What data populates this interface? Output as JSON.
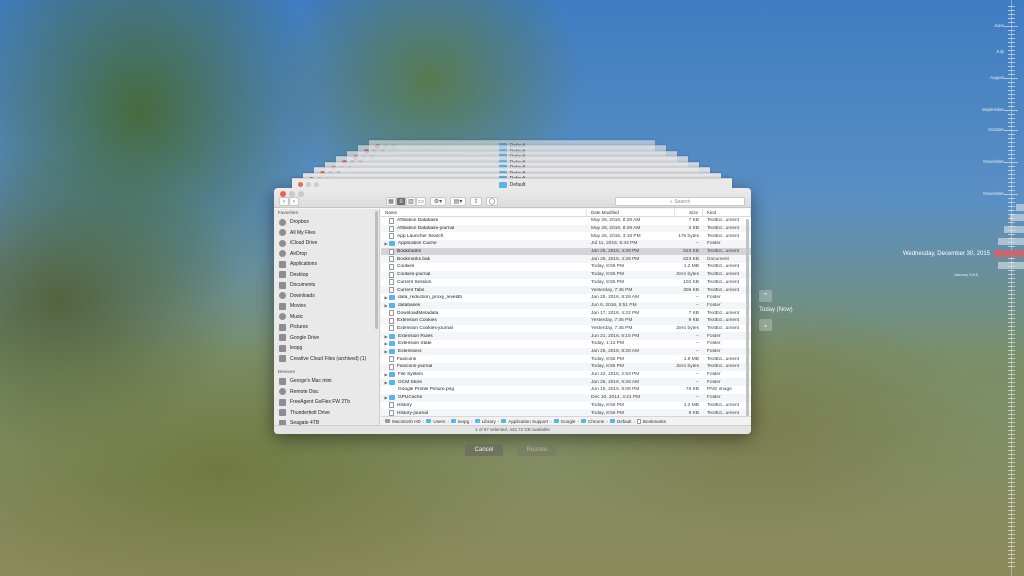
{
  "window_stack": [
    {
      "title": "Default"
    },
    {
      "title": "Default"
    },
    {
      "title": "Default"
    },
    {
      "title": "Default"
    },
    {
      "title": "Default"
    },
    {
      "title": "Default"
    },
    {
      "title": "Default"
    },
    {
      "title": "Default"
    }
  ],
  "finder": {
    "search_placeholder": "Search",
    "sidebar": {
      "favorites_heading": "Favorites",
      "favorites": [
        {
          "label": "Dropbox",
          "icon": "dropbox-icon"
        },
        {
          "label": "All My Files",
          "icon": "all-files-icon"
        },
        {
          "label": "iCloud Drive",
          "icon": "cloud-icon"
        },
        {
          "label": "AirDrop",
          "icon": "airdrop-icon"
        },
        {
          "label": "Applications",
          "icon": "applications-icon"
        },
        {
          "label": "Desktop",
          "icon": "desktop-icon"
        },
        {
          "label": "Documents",
          "icon": "documents-icon"
        },
        {
          "label": "Downloads",
          "icon": "downloads-icon"
        },
        {
          "label": "Movies",
          "icon": "movies-icon"
        },
        {
          "label": "Music",
          "icon": "music-icon"
        },
        {
          "label": "Pictures",
          "icon": "pictures-icon"
        },
        {
          "label": "Google Drive",
          "icon": "google-drive-icon"
        },
        {
          "label": "leopg",
          "icon": "home-icon"
        },
        {
          "label": "Creative Cloud Files (archived) (1)",
          "icon": "folder-icon"
        }
      ],
      "devices_heading": "Devices",
      "devices": [
        {
          "label": "George's Mac mini",
          "icon": "computer-icon"
        },
        {
          "label": "Remote Disc",
          "icon": "disc-icon"
        },
        {
          "label": "FreeAgent GoFlex FW 2Tb",
          "icon": "drive-icon"
        },
        {
          "label": "Thunderbolt Drive",
          "icon": "drive-icon"
        },
        {
          "label": "Seagate 4TB",
          "icon": "drive-icon"
        }
      ]
    },
    "columns": {
      "name": "Name",
      "date": "Date Modified",
      "size": "Size",
      "kind": "Kind"
    },
    "files": [
      {
        "name": "Affiliation Database",
        "date": "May 28, 2016, 8:29 AM",
        "size": "7 KB",
        "kind": "TextEd...ument",
        "type": "file"
      },
      {
        "name": "Affiliation Database-journal",
        "date": "May 28, 2016, 8:29 AM",
        "size": "2 KB",
        "kind": "TextEd...ument",
        "type": "file"
      },
      {
        "name": "App Launcher Search",
        "date": "May 28, 2016, 3:18 PM",
        "size": "176 bytes",
        "kind": "TextEd...ument",
        "type": "file"
      },
      {
        "name": "Application Cache",
        "date": "Jul 11, 2016, 6:44 PM",
        "size": "--",
        "kind": "Folder",
        "type": "folder"
      },
      {
        "name": "Bookmarks",
        "date": "Jan 25, 2016, 4:28 PM",
        "size": "623 KB",
        "kind": "TextEd...ument",
        "type": "file",
        "selected": true
      },
      {
        "name": "Bookmarks.bak",
        "date": "Jan 25, 2016, 4:28 PM",
        "size": "623 KB",
        "kind": "Document",
        "type": "file"
      },
      {
        "name": "Cookies",
        "date": "Today, 8:56 PM",
        "size": "1.2 MB",
        "kind": "TextEd...ument",
        "type": "file"
      },
      {
        "name": "Cookies-journal",
        "date": "Today, 8:56 PM",
        "size": "Zero bytes",
        "kind": "TextEd...ument",
        "type": "file"
      },
      {
        "name": "Current Session",
        "date": "Today, 8:55 PM",
        "size": "102 KB",
        "kind": "TextEd...ument",
        "type": "file"
      },
      {
        "name": "Current Tabs",
        "date": "Yesterday, 7:45 PM",
        "size": "306 KB",
        "kind": "TextEd...ument",
        "type": "file"
      },
      {
        "name": "data_reduction_proxy_leveldb",
        "date": "Jan 25, 2016, 8:28 AM",
        "size": "--",
        "kind": "Folder",
        "type": "folder"
      },
      {
        "name": "databases",
        "date": "Jun 6, 2016, 5:51 PM",
        "size": "--",
        "kind": "Folder",
        "type": "folder"
      },
      {
        "name": "DownloadMetadata",
        "date": "Jan 17, 2016, 4:22 PM",
        "size": "7 KB",
        "kind": "TextEd...ument",
        "type": "file"
      },
      {
        "name": "Extension Cookies",
        "date": "Yesterday, 7:45 PM",
        "size": "9 KB",
        "kind": "TextEd...ument",
        "type": "file"
      },
      {
        "name": "Extension Cookies-journal",
        "date": "Yesterday, 7:45 PM",
        "size": "Zero bytes",
        "kind": "TextEd...ument",
        "type": "file"
      },
      {
        "name": "Extension Rules",
        "date": "Jun 21, 2016, 6:15 PM",
        "size": "--",
        "kind": "Folder",
        "type": "folder"
      },
      {
        "name": "Extension State",
        "date": "Today, 1:13 PM",
        "size": "--",
        "kind": "Folder",
        "type": "folder"
      },
      {
        "name": "Extensions",
        "date": "Jan 25, 2016, 8:28 AM",
        "size": "--",
        "kind": "Folder",
        "type": "folder"
      },
      {
        "name": "Favicons",
        "date": "Today, 8:55 PM",
        "size": "1.8 MB",
        "kind": "TextEd...ument",
        "type": "file"
      },
      {
        "name": "Favicons-journal",
        "date": "Today, 8:55 PM",
        "size": "Zero bytes",
        "kind": "TextEd...ument",
        "type": "file"
      },
      {
        "name": "File System",
        "date": "Jun 22, 2016, 2:53 PM",
        "size": "--",
        "kind": "Folder",
        "type": "folder"
      },
      {
        "name": "GCM Store",
        "date": "Jan 25, 2016, 8:28 AM",
        "size": "--",
        "kind": "Folder",
        "type": "folder"
      },
      {
        "name": "Google Profile Picture.png",
        "date": "Jun 15, 2016, 9:08 PM",
        "size": "76 KB",
        "kind": "PNG image",
        "type": "image"
      },
      {
        "name": "GPUCache",
        "date": "Dec 10, 2014, 4:21 PM",
        "size": "--",
        "kind": "Folder",
        "type": "folder"
      },
      {
        "name": "History",
        "date": "Today, 8:55 PM",
        "size": "1.2 MB",
        "kind": "TextEd...ument",
        "type": "file"
      },
      {
        "name": "History-journal",
        "date": "Today, 8:56 PM",
        "size": "9 KB",
        "kind": "TextEd...ument",
        "type": "file"
      }
    ],
    "path": [
      {
        "label": "Macintosh HD",
        "icon": "hd"
      },
      {
        "label": "Users",
        "icon": "folder"
      },
      {
        "label": "leopg",
        "icon": "folder"
      },
      {
        "label": "Library",
        "icon": "folder"
      },
      {
        "label": "Application Support",
        "icon": "folder"
      },
      {
        "label": "Google",
        "icon": "folder"
      },
      {
        "label": "Chrome",
        "icon": "folder"
      },
      {
        "label": "Default",
        "icon": "folder"
      },
      {
        "label": "Bookmarks",
        "icon": "file"
      }
    ],
    "status": "1 of 67 selected, 442.72 GB available"
  },
  "buttons": {
    "cancel": "Cancel",
    "restore": "Restore"
  },
  "navigation": {
    "up_icon": "chevron-up-icon",
    "down_icon": "chevron-down-icon",
    "current_label": "Today (Now)"
  },
  "timeline": {
    "months": [
      "June",
      "July",
      "August",
      "September",
      "October",
      "November",
      "December"
    ],
    "current_date": "Wednesday, December 30, 2015",
    "year_label": "January 2016"
  },
  "colors": {
    "folder": "#5ab4e8",
    "close": "#ee5c54",
    "timeline_now": "#c46a70"
  }
}
